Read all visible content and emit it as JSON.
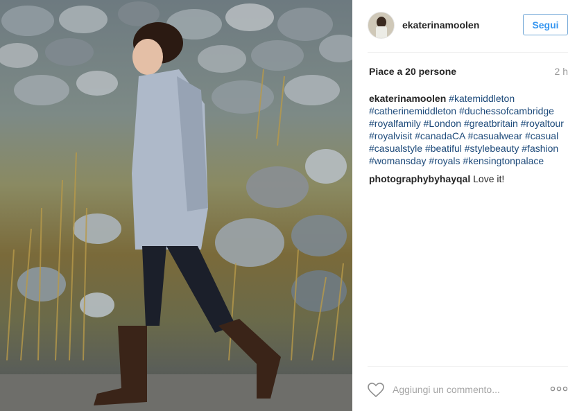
{
  "post": {
    "username": "ekaterinamoolen",
    "follow_label": "Segui",
    "likes_text": "Piace a 20 persone",
    "time_ago": "2 h",
    "caption": {
      "author": "ekaterinamoolen",
      "tags": [
        "#katemiddleton",
        "#catherinemiddleton",
        "#duchessofcambridge",
        "#royalfamily",
        "#London",
        "#greatbritain",
        "#royaltour",
        "#royalvisit",
        "#canadaCA",
        "#casualwear",
        "#casual",
        "#casualstyle",
        "#beatiful",
        "#stylebeauty",
        "#fashion",
        "#womansday",
        "#royals",
        "#kensingtonpalace"
      ]
    },
    "comments": [
      {
        "author": "photographybyhayqal",
        "text": "Love it!"
      }
    ],
    "add_comment_placeholder": "Aggiungi un commento...",
    "more_icon": "ellipsis-icon",
    "like_icon": "heart-icon"
  },
  "colors": {
    "follow_border": "#70a6d6",
    "follow_text": "#3897f0",
    "hashtag": "#1d4a7a"
  }
}
